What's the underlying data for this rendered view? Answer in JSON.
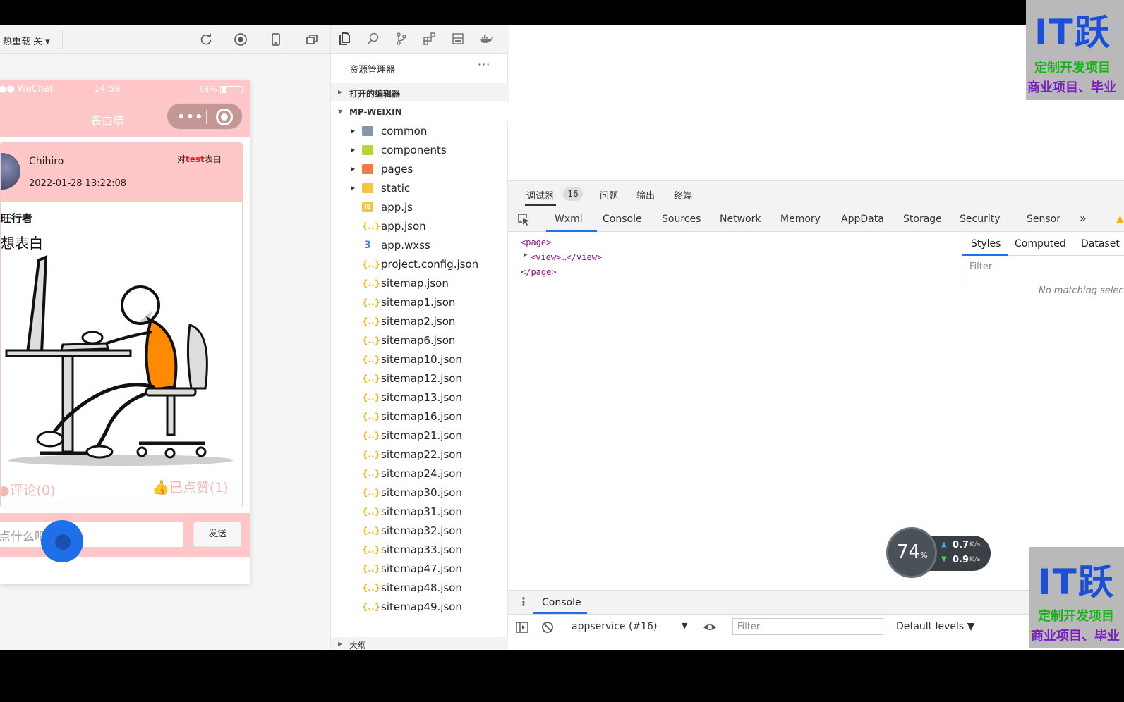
{
  "simulator": {
    "hot_reload": "热重载 关 ▾",
    "status": {
      "carrier": "●● WeChat",
      "time": "14:59",
      "battery": "18%"
    },
    "nav_title": "表白墙",
    "capsule_dots": "•••",
    "post": {
      "user": "Chihiro",
      "time": "2022-01-28 13:22:08",
      "to_prefix": "对",
      "to_user": "test",
      "to_suffix": "表白",
      "author": "旺行者",
      "text": "想表白",
      "comments": "评论(0)",
      "likes": "已点赞(1)"
    },
    "reply_placeholder": "点什么吧...",
    "send": "发送"
  },
  "explorer": {
    "title": "资源管理器",
    "more": "···",
    "open_editors": "打开的编辑器",
    "project": "MP-WEIXIN",
    "outline": "大纲",
    "folders": [
      "common",
      "components",
      "pages",
      "static"
    ],
    "files": [
      "app.js",
      "app.json",
      "app.wxss",
      "project.config.json",
      "sitemap.json",
      "sitemap1.json",
      "sitemap2.json",
      "sitemap6.json",
      "sitemap10.json",
      "sitemap12.json",
      "sitemap13.json",
      "sitemap16.json",
      "sitemap21.json",
      "sitemap22.json",
      "sitemap24.json",
      "sitemap30.json",
      "sitemap31.json",
      "sitemap32.json",
      "sitemap33.json",
      "sitemap47.json",
      "sitemap48.json",
      "sitemap49.json"
    ]
  },
  "devtools": {
    "top_tabs": {
      "debugger": "调试器",
      "badge": "16",
      "issues": "问题",
      "output": "输出",
      "terminal": "终端"
    },
    "panel_tabs": [
      "Wxml",
      "Console",
      "Sources",
      "Network",
      "Memory",
      "AppData",
      "Storage",
      "Security",
      "Sensor"
    ],
    "more_tabs": "»",
    "wxml": {
      "open": "<page>",
      "child": "<view>…</view>",
      "close": "</page>"
    },
    "styles_tabs": [
      "Styles",
      "Computed",
      "Dataset"
    ],
    "styles_filter": "Filter",
    "no_match": "No matching selec",
    "drawer_tab": "Console",
    "context": "appservice (#16)",
    "console_filter": "Filter",
    "levels": "Default levels ▼"
  },
  "speed": {
    "percent": "74",
    "unit": "%",
    "up": "0.7",
    "down": "0.9",
    "rate_unit": "K/s"
  },
  "watermark": {
    "brand": "IT跃",
    "line1": "定制开发项目",
    "line2": "商业项目、毕业"
  }
}
